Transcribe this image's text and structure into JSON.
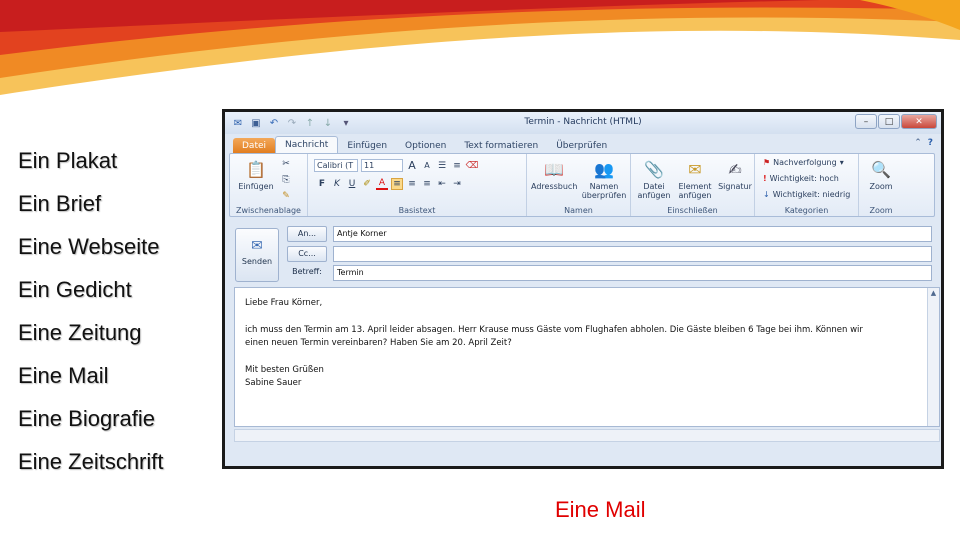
{
  "slide": {
    "items": [
      "Ein Plakat",
      "Ein Brief",
      "Eine Webseite",
      "Ein Gedicht",
      "Eine Zeitung",
      "Eine Mail",
      "Eine Biografie",
      "Eine Zeitschrift"
    ],
    "answer": "Eine Mail",
    "answer_color": "#e00000"
  },
  "window": {
    "title": "Termin - Nachricht (HTML)",
    "tabs": [
      "Datei",
      "Nachricht",
      "Einfügen",
      "Optionen",
      "Text formatieren",
      "Überprüfen"
    ],
    "active_tab": "Nachricht"
  },
  "ribbon": {
    "paste": "Einfügen",
    "clipboard": "Zwischenablage",
    "font_name": "Calibri (T",
    "font_size": "11",
    "bold": "F",
    "italic": "K",
    "underline": "U",
    "basic_text": "Basistext",
    "address_book": "Adressbuch",
    "check_names": "Namen überprüfen",
    "names": "Namen",
    "attach_file": "Datei anfügen",
    "attach_item": "Element anfügen",
    "signature": "Signatur",
    "include": "Einschließen",
    "follow_up": "Nachverfolgung",
    "high_importance": "Wichtigkeit: hoch",
    "low_importance": "Wichtigkeit: niedrig",
    "categories": "Kategorien",
    "zoom_btn": "Zoom",
    "zoom_group": "Zoom"
  },
  "header": {
    "send": "Senden",
    "to_label": "An...",
    "to_value": "Antje Korner",
    "cc_label": "Cc...",
    "cc_value": "",
    "subject_label": "Betreff:",
    "subject_value": "Termin"
  },
  "mail": {
    "greeting": "Liebe Frau Körner,",
    "line1": "ich muss den Termin am 13. April leider absagen. Herr Krause muss Gäste vom Flughafen abholen. Die Gäste bleiben 6 Tage bei ihm. Können wir",
    "line2": "einen neuen Termin vereinbaren? Haben Sie am 20. April Zeit?",
    "closing": "Mit besten Grüßen",
    "signature": "Sabine Sauer"
  }
}
